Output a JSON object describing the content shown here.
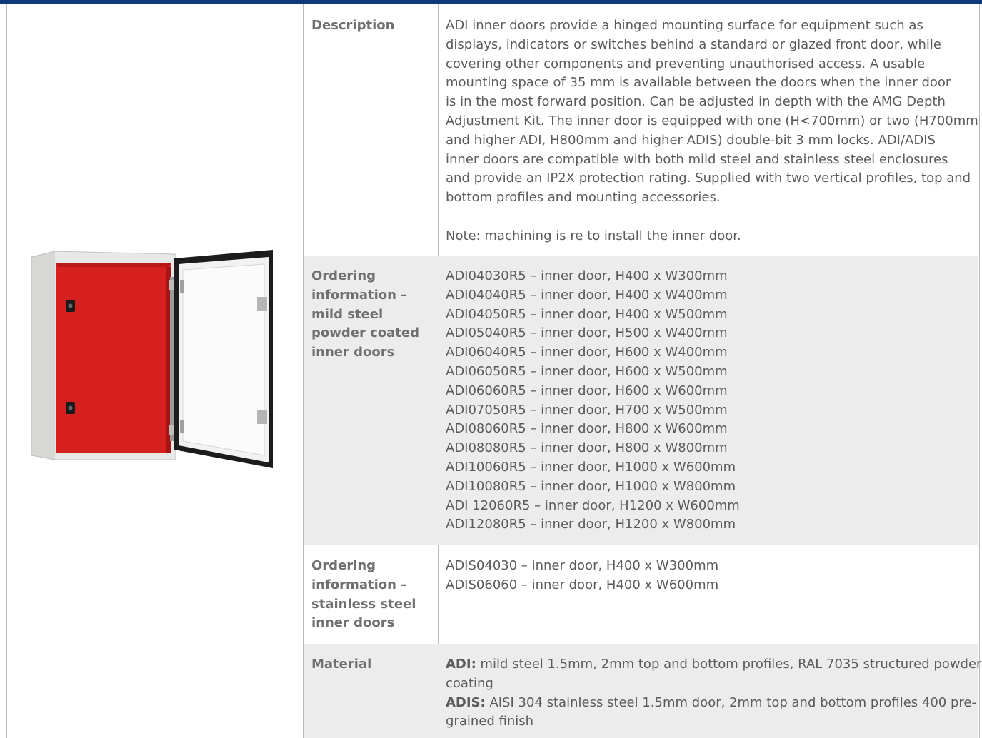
{
  "description": {
    "label": "Description",
    "lines": [
      "ADI inner doors provide a hinged mounting surface for equipment such as",
      "displays, indicators or switches behind a standard or glazed front door, while",
      "covering other components and preventing unauthorised access. A usable",
      "mounting space of 35 mm is available between the doors when the inner door",
      "is in the most forward position. Can be adjusted in depth with the AMG Depth",
      "Adjustment Kit. The inner door is equipped with one (H<700mm) or two (H700mm",
      "and higher ADI, H800mm and higher ADIS) double-bit 3 mm locks. ADI/ADIS",
      "inner doors are compatible with both mild steel and stainless steel enclosures",
      "and provide an IP2X protection rating. Supplied with two vertical profiles, top and",
      "bottom profiles and mounting accessories."
    ],
    "note": "Note: machining is re to install the inner door."
  },
  "mild_steel": {
    "label_lines": [
      "Ordering",
      "information –",
      "mild steel",
      "powder coated",
      "inner doors"
    ],
    "items": [
      "ADI04030R5 – inner door, H400 x W300mm",
      "ADI04040R5 – inner door, H400 x W400mm",
      "ADI04050R5 – inner door, H400 x W500mm",
      "ADI05040R5 – inner door, H500 x W400mm",
      "ADI06040R5 – inner door, H600 x W400mm",
      "ADI06050R5 – inner door, H600 x W500mm",
      "ADI06060R5 – inner door, H600 x W600mm",
      "ADI07050R5 – inner door, H700 x W500mm",
      "ADI08060R5 – inner door, H800 x W600mm",
      "ADI08080R5 – inner door, H800 x W800mm",
      "ADI10060R5 – inner door, H1000 x W600mm",
      "ADI10080R5 – inner door, H1000 x W800mm",
      "ADI 12060R5 – inner door, H1200 x W600mm",
      "ADI12080R5 – inner door, H1200 x W800mm"
    ]
  },
  "stainless": {
    "label_lines": [
      "Ordering",
      "information –",
      "stainless steel",
      "inner doors"
    ],
    "items": [
      "ADIS04030 – inner door, H400 x W300mm",
      "ADIS06060 – inner door, H400 x W600mm"
    ]
  },
  "material": {
    "label": "Material",
    "adi_label": "ADI:",
    "adi_line1": " mild steel 1.5mm, 2mm top and bottom profiles, RAL 7035 structured powder",
    "adi_line2": "coating",
    "adis_label": "ADIS:",
    "adis_line1": " AISI 304 stainless steel 1.5mm door, 2mm top and bottom profiles 400 pre-",
    "adis_line2": "grained finish"
  },
  "colors": {
    "header_bar": "#103a7d",
    "row_shade": "#ececec",
    "enclosure_interior": "#d41f1f",
    "enclosure_body": "#e6e6e4"
  }
}
